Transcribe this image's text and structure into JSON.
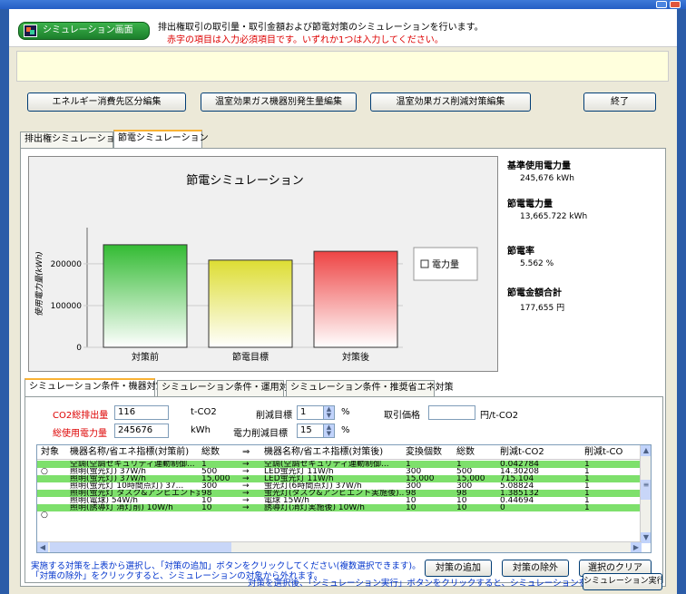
{
  "header": {
    "badge": "シミュレーション画面",
    "description": "排出権取引の取引量・取引金額および節電対策のシミュレーションを行います。",
    "required_note": "赤字の項目は入力必須項目です。いずれか1つは入力してください。"
  },
  "toolbar": {
    "energy_btn": "エネルギー消費先区分編集",
    "ghg_device_btn": "温室効果ガス機器別発生量編集",
    "ghg_reduce_btn": "温室効果ガス削減対策編集",
    "exit_btn": "終了"
  },
  "tabs_top": [
    "排出権シミュレーション",
    "節電シミュレーション"
  ],
  "chart_data": {
    "type": "bar",
    "title": "節電シミュレーション",
    "ylabel": "使用電力量(kWh)",
    "categories": [
      "対策前",
      "節電目標",
      "対策後"
    ],
    "values": [
      245676,
      208825,
      230000
    ],
    "ylim": [
      0,
      265000
    ],
    "yticks": [
      "0",
      "100000",
      "200000"
    ],
    "legend": "電力量",
    "colors": [
      "#33bb33",
      "#dddd33",
      "#ee4444"
    ]
  },
  "stats": {
    "base_label": "基準使用電力量",
    "base_value": "245,676 kWh",
    "saving_label": "節電電力量",
    "saving_value": "13,665.722 kWh",
    "rate_label": "節電率",
    "rate_value": "5.562 %",
    "amount_label": "節電金額合計",
    "amount_value": "177,655 円"
  },
  "tabs_bottom": [
    "シミュレーション条件・機器対策",
    "シミュレーション条件・運用対策",
    "シミュレーション条件・推奨省エネ対策"
  ],
  "form": {
    "co2_label": "CO2総排出量",
    "co2_value": "116",
    "co2_unit": "t-CO2",
    "reduce_target_label": "削減目標",
    "reduce_target_value": "1",
    "percent": "%",
    "price_label": "取引価格",
    "price_value": "",
    "price_unit": "円/t-CO2",
    "power_label": "総使用電力量",
    "power_value": "245676",
    "power_unit": "kWh",
    "power_target_label": "電力削減目標",
    "power_target_value": "15"
  },
  "grid": {
    "headers": [
      "対象",
      "機器名称/省エネ指標(対策前)",
      "総数",
      "⇒",
      "機器名称/省エネ指標(対策後)",
      "変換個数",
      "総数",
      "削減t-CO2",
      "削減t-CO"
    ],
    "rows": [
      [
        "",
        "空調(空調セキュリティ連動制御...",
        "1",
        "→",
        "空調(空調セキュリティ連動制御...",
        "1",
        "1",
        "0.042784",
        "1"
      ],
      [
        "○",
        "照明(蛍光灯) 37W/h",
        "500",
        "→",
        "LED蛍光灯 11W/h",
        "300",
        "500",
        "14.30208",
        "1"
      ],
      [
        "",
        "照明(蛍光灯) 37W/h",
        "15,000",
        "→",
        "LED蛍光灯 11W/h",
        "15,000",
        "15,000",
        "715.104",
        "1"
      ],
      [
        "",
        "照明(蛍光灯 10時間点灯) 37...",
        "300",
        "→",
        "蛍光灯(6時間点灯) 37W/h",
        "300",
        "300",
        "5.08824",
        "1"
      ],
      [
        "",
        "照明(蛍光灯 タスク&アンビエント実...",
        "98",
        "→",
        "蛍光灯(タスク&アンビエント実施後)...",
        "98",
        "98",
        "1.385132",
        "1"
      ],
      [
        "",
        "照明(電球) 54W/h",
        "10",
        "→",
        "電球 15W/h",
        "10",
        "10",
        "0.44694",
        "1"
      ],
      [
        "",
        "照明(誘導灯 消灯前) 10W/h",
        "10",
        "→",
        "誘導灯(消灯実施後) 10W/h",
        "10",
        "10",
        "0",
        "1"
      ],
      [
        "○",
        "",
        "",
        "",
        "",
        "",
        "",
        "",
        ""
      ]
    ]
  },
  "notes": {
    "line1": "実施する対策を上表から選択し、「対策の追加」ボタンをクリックしてください(複数選択できます)。",
    "line2": "「対策の除外」をクリックすると、シミュレーションの対象から外れます。",
    "footer": "対策を選択後、「シミュレーション実行」ボタンをクリックすると、シミュレーションを開始します。"
  },
  "buttons": {
    "add": "対策の追加",
    "remove": "対策の除外",
    "clear": "選択のクリア",
    "run": "シミュレーション実行"
  }
}
